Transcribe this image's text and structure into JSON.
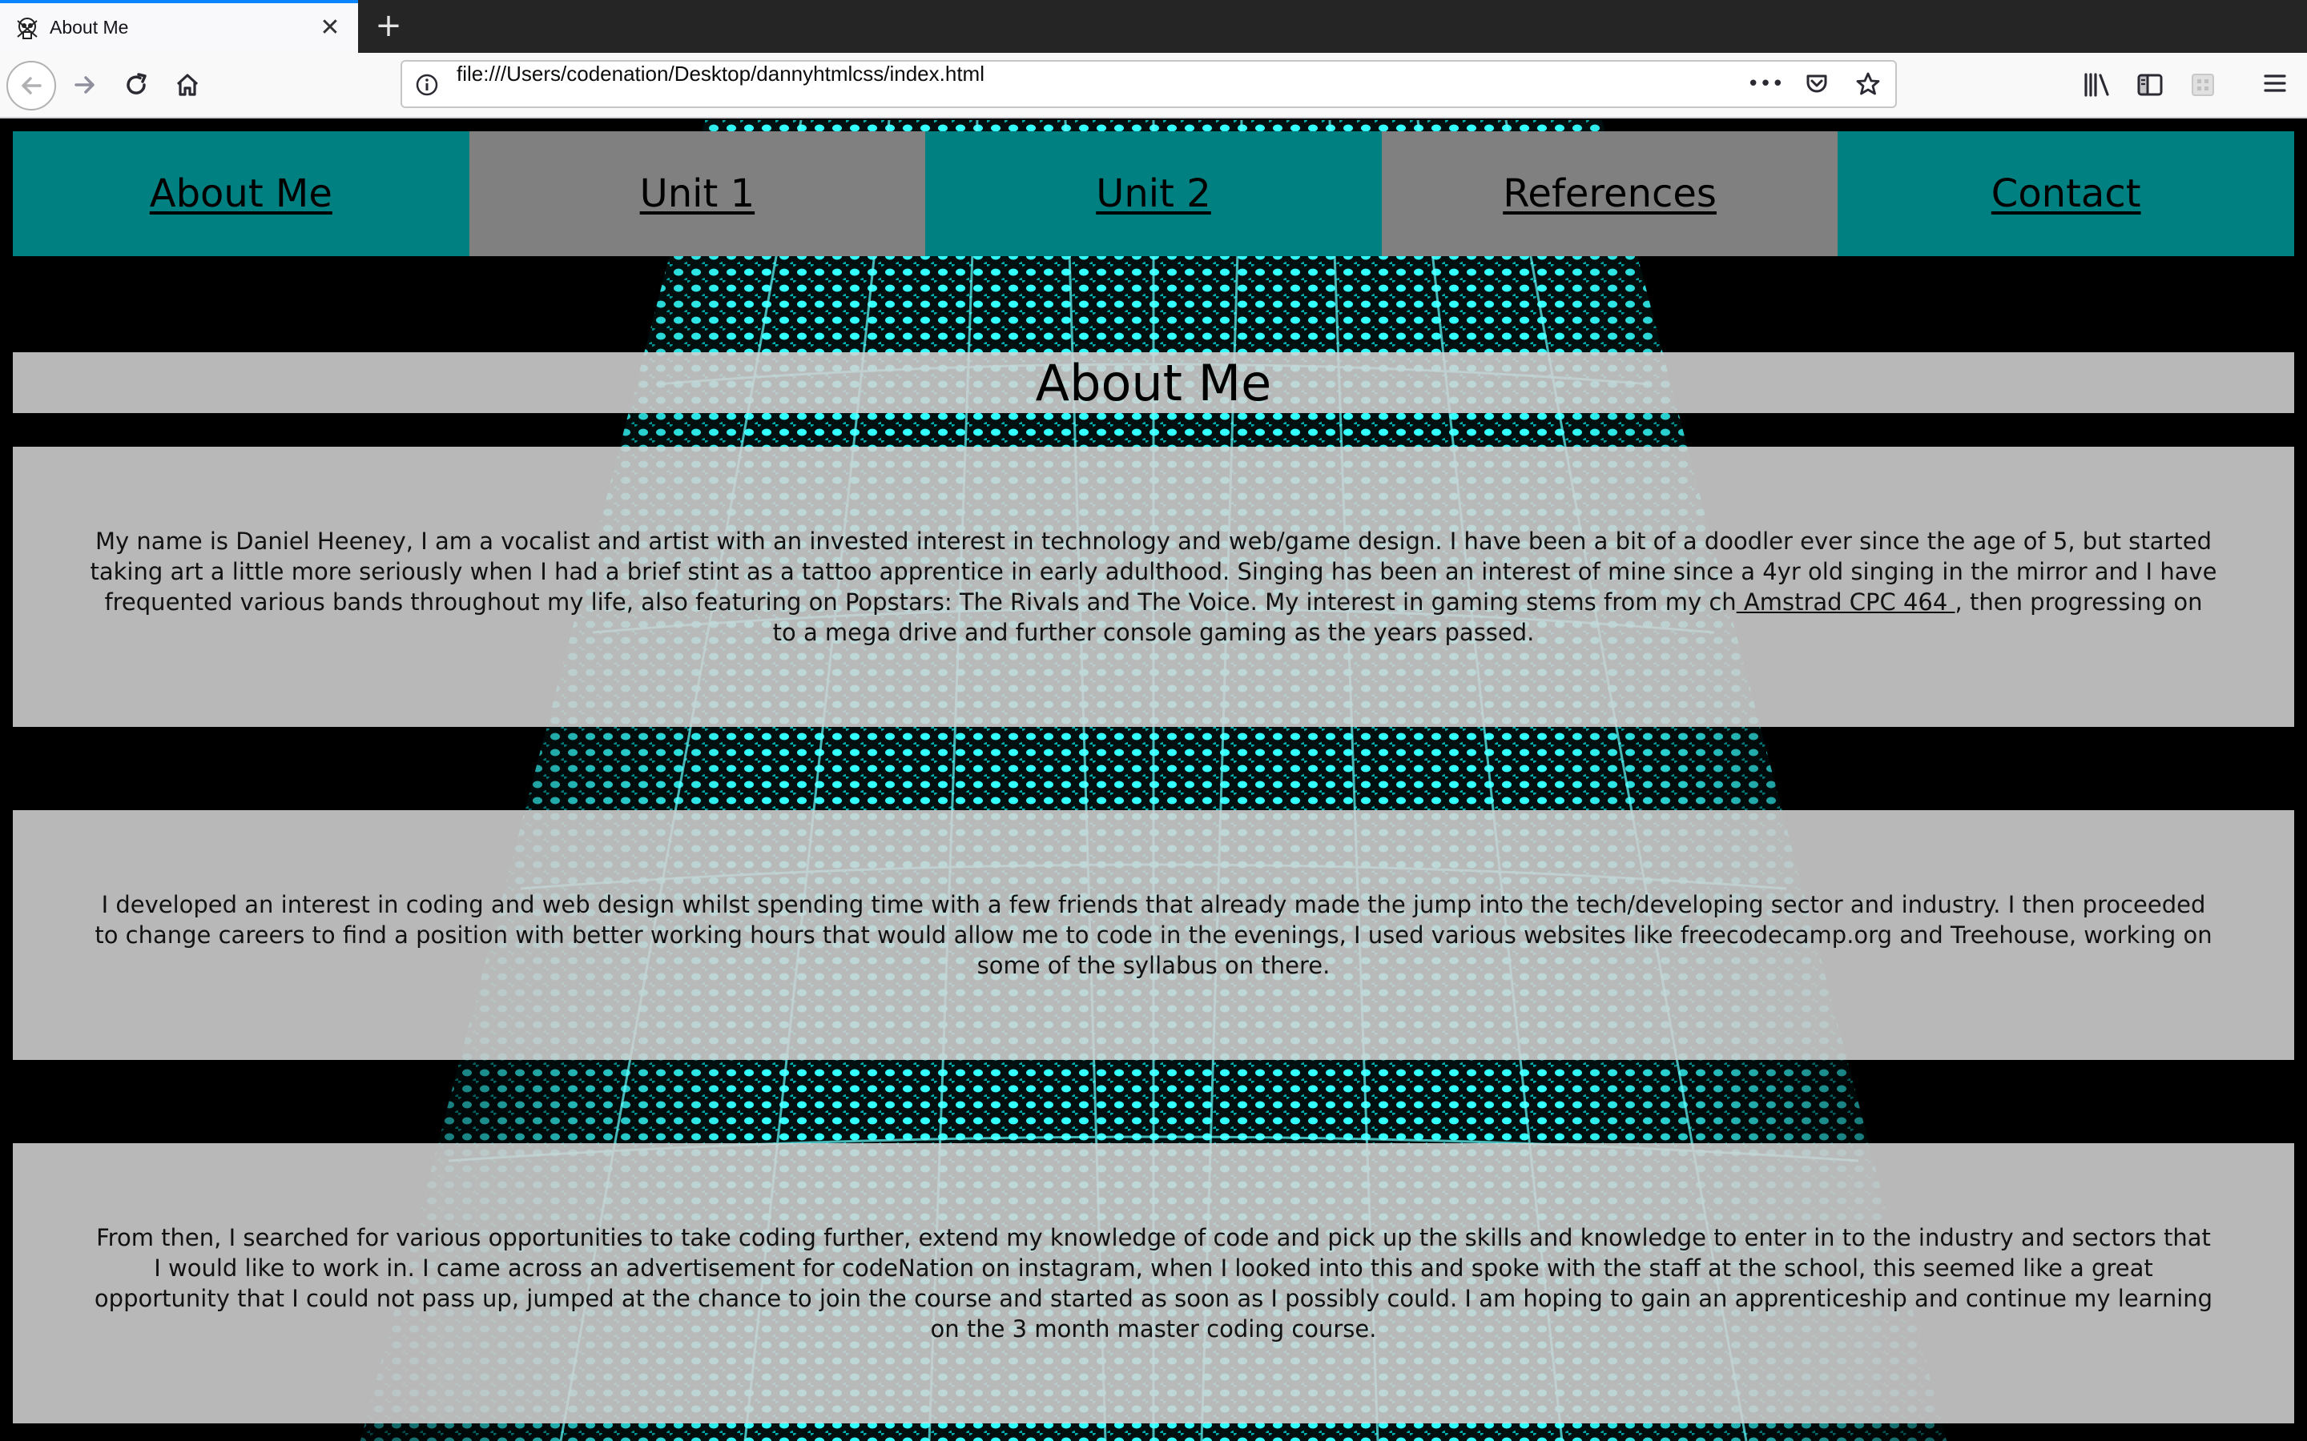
{
  "browser": {
    "tab_title": "About Me",
    "tab_close": "✕",
    "new_tab": "+",
    "url": "file:///Users/codenation/Desktop/dannyhtmlcss/index.html",
    "url_more": "•••"
  },
  "site_nav": [
    {
      "label": "About Me",
      "color": "#008080"
    },
    {
      "label": "Unit 1",
      "color": "#808080"
    },
    {
      "label": "Unit 2",
      "color": "#008080"
    },
    {
      "label": "References",
      "color": "#808080"
    },
    {
      "label": "Contact",
      "color": "#008080"
    }
  ],
  "page": {
    "title": "About Me",
    "para1_before": "My name is Daniel Heeney, I am a vocalist and artist with an invested interest in technology and web/game design. I have been a bit of a doodler ever since the age of 5, but started taking art a little more seriously when I had a brief stint as a tattoo apprentice in early adulthood. Singing has been an interest of mine since a 4yr old singing in the mirror and I have frequented various bands throughout my life, also featuring on Popstars: The Rivals and The Voice. My interest in gaming stems from my ch",
    "para1_link": " Amstrad CPC 464 ",
    "para1_after": ", then progressing on to a mega drive and further console gaming as the years passed.",
    "para2": "I developed an interest in coding and web design whilst spending time with a few friends that already made the jump into the tech/developing sector and industry. I then proceeded to change careers to find a position with better working hours that would allow me to code in the evenings, I used various websites like freecodecamp.org and Treehouse, working on some of the syllabus on there.",
    "para3": "From then, I searched for various opportunities to take coding further, extend my knowledge of code and pick up the skills and knowledge to enter in to the industry and sectors that I would like to work in. I came across an advertisement for codeNation on instagram, when I looked into this and spoke with the staff at the school, this seemed like a great opportunity that I could not pass up, jumped at the chance to join the course and started as soon as I possibly could. I am hoping to gain an apprenticeship and continue my learning on the 3 month master coding course."
  },
  "colors": {
    "teal": "#008080",
    "grey": "#808080",
    "tunnel": "#00ffff",
    "panel": "#d2d2d2"
  }
}
